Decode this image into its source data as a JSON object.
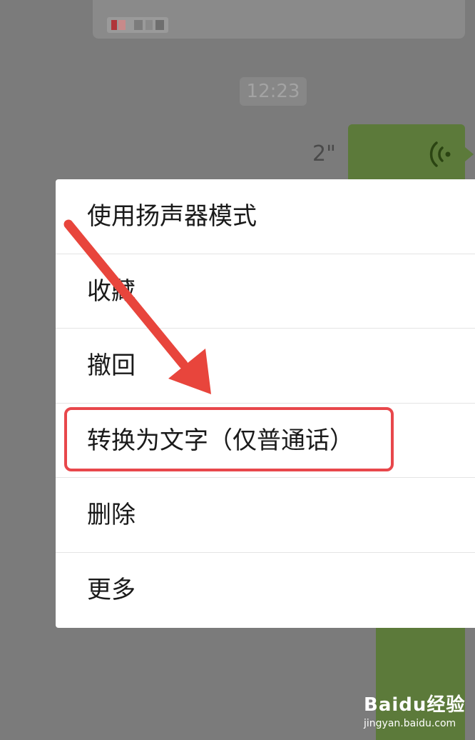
{
  "chat": {
    "timestamp": "12:23",
    "voice_duration": "2\""
  },
  "context_menu": {
    "items": [
      {
        "label": "使用扬声器模式"
      },
      {
        "label": "收藏"
      },
      {
        "label": "撤回"
      },
      {
        "label": "转换为文字（仅普通话）"
      },
      {
        "label": "删除"
      },
      {
        "label": "更多"
      }
    ]
  },
  "watermark": {
    "logo": "Baidu经验",
    "url": "jingyan.baidu.com"
  },
  "colors": {
    "overlay": "#7b7b7b",
    "bubble_green": "#5c7a3a",
    "highlight_red": "#e8474b",
    "arrow_red": "#e8453c"
  },
  "icons": {
    "voice": "voice-wave-icon",
    "annotation": "annotation-arrow-icon"
  }
}
